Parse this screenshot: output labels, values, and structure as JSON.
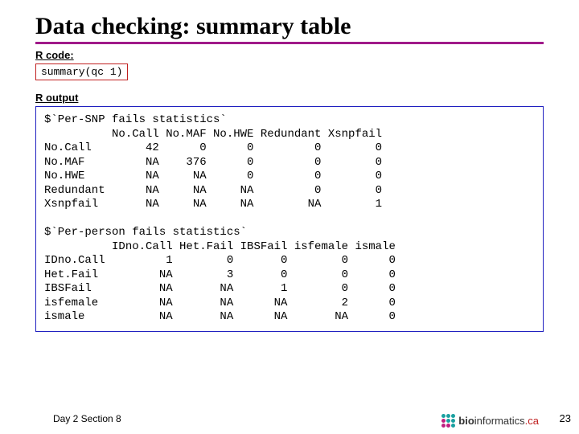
{
  "title": "Data checking: summary table",
  "labels": {
    "code": "R code:",
    "output": "R output"
  },
  "code": "summary(qc 1)",
  "output": "$`Per-SNP fails statistics`\n          No.Call No.MAF No.HWE Redundant Xsnpfail\nNo.Call        42      0      0         0        0\nNo.MAF         NA    376      0         0        0\nNo.HWE         NA     NA      0         0        0\nRedundant      NA     NA     NA         0        0\nXsnpfail       NA     NA     NA        NA        1\n\n$`Per-person fails statistics`\n          IDno.Call Het.Fail IBSFail isfemale ismale\nIDno.Call         1        0       0        0      0\nHet.Fail         NA        3       0        0      0\nIBSFail          NA       NA       1        0      0\nisfemale         NA       NA      NA        2      0\nismale           NA       NA      NA       NA      0",
  "footer": {
    "left": "Day 2 Section 8",
    "page": "23"
  },
  "logo": {
    "brand1": "bio",
    "brand2": "informatics",
    "suffix": ".ca"
  },
  "chart_data": [
    {
      "type": "table",
      "title": "$`Per-SNP fails statistics`",
      "columns": [
        "No.Call",
        "No.MAF",
        "No.HWE",
        "Redundant",
        "Xsnpfail"
      ],
      "rows": [
        "No.Call",
        "No.MAF",
        "No.HWE",
        "Redundant",
        "Xsnpfail"
      ],
      "values": [
        [
          42,
          0,
          0,
          0,
          0
        ],
        [
          "NA",
          376,
          0,
          0,
          0
        ],
        [
          "NA",
          "NA",
          0,
          0,
          0
        ],
        [
          "NA",
          "NA",
          "NA",
          0,
          0
        ],
        [
          "NA",
          "NA",
          "NA",
          "NA",
          1
        ]
      ]
    },
    {
      "type": "table",
      "title": "$`Per-person fails statistics`",
      "columns": [
        "IDno.Call",
        "Het.Fail",
        "IBSFail",
        "isfemale",
        "ismale"
      ],
      "rows": [
        "IDno.Call",
        "Het.Fail",
        "IBSFail",
        "isfemale",
        "ismale"
      ],
      "values": [
        [
          1,
          0,
          0,
          0,
          0
        ],
        [
          "NA",
          3,
          0,
          0,
          0
        ],
        [
          "NA",
          "NA",
          1,
          0,
          0
        ],
        [
          "NA",
          "NA",
          "NA",
          2,
          0
        ],
        [
          "NA",
          "NA",
          "NA",
          "NA",
          0
        ]
      ]
    }
  ]
}
